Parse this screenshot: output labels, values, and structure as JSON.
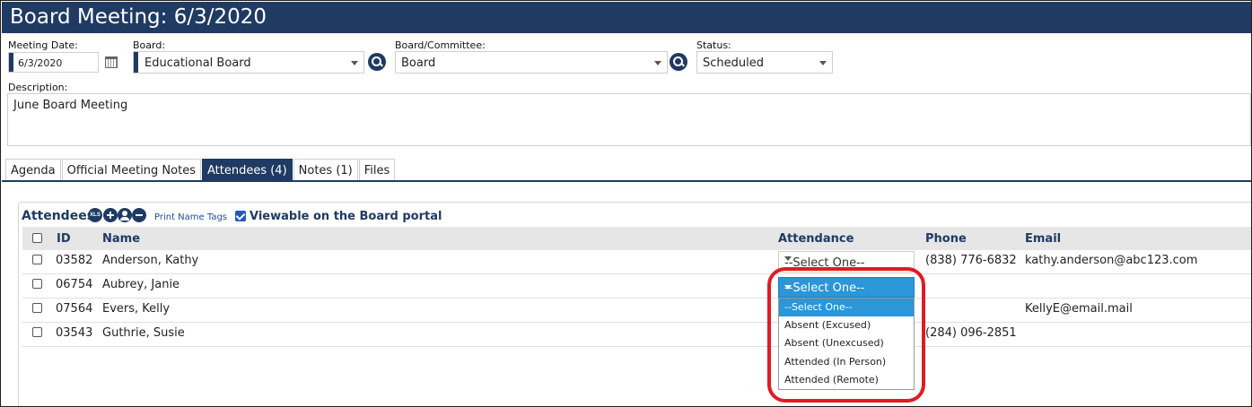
{
  "page_title": "Board Meeting: 6/3/2020",
  "form": {
    "meeting_date_label": "Meeting Date:",
    "meeting_date_value": "6/3/2020",
    "board_label": "Board:",
    "board_value": "Educational Board",
    "committee_label": "Board/Committee:",
    "committee_value": "Board",
    "status_label": "Status:",
    "status_value": "Scheduled",
    "description_label": "Description:",
    "description_value": "June Board Meeting"
  },
  "tabs": [
    {
      "label": "Agenda"
    },
    {
      "label": "Official Meeting Notes"
    },
    {
      "label": "Attendees (4)",
      "active": true
    },
    {
      "label": "Notes (1)"
    },
    {
      "label": "Files"
    }
  ],
  "attendees": {
    "title": "Attendees",
    "xls_label": "XLS",
    "print_link": "Print Name Tags",
    "viewable_label": "Viewable on the Board portal",
    "columns": {
      "id": "ID",
      "name": "Name",
      "attendance": "Attendance",
      "phone": "Phone",
      "email": "Email"
    },
    "rows": [
      {
        "id": "03582",
        "name": "Anderson, Kathy",
        "attendance": "--Select One--",
        "phone": "(838) 776-6832",
        "email": "kathy.anderson@abc123.com"
      },
      {
        "id": "06754",
        "name": "Aubrey, Janie",
        "attendance": "--Select One--",
        "phone": "",
        "email": ""
      },
      {
        "id": "07564",
        "name": "Evers, Kelly",
        "attendance": "",
        "phone": "",
        "email": "KellyE@email.mail"
      },
      {
        "id": "03543",
        "name": "Guthrie, Susie",
        "attendance": "",
        "phone": "(284) 096-2851",
        "email": ""
      }
    ],
    "dropdown_options": [
      "--Select One--",
      "Absent (Excused)",
      "Absent (Unexcused)",
      "Attended (In Person)",
      "Attended (Remote)"
    ]
  },
  "colors": {
    "brand": "#1f3a63",
    "select_highlight": "#2b96d8",
    "annotation": "#e01b24"
  },
  "icons": [
    "calendar-icon",
    "search-icon",
    "xls-export-icon",
    "add-icon",
    "person-icon",
    "remove-icon",
    "checkbox-icon",
    "chevron-down-icon"
  ]
}
